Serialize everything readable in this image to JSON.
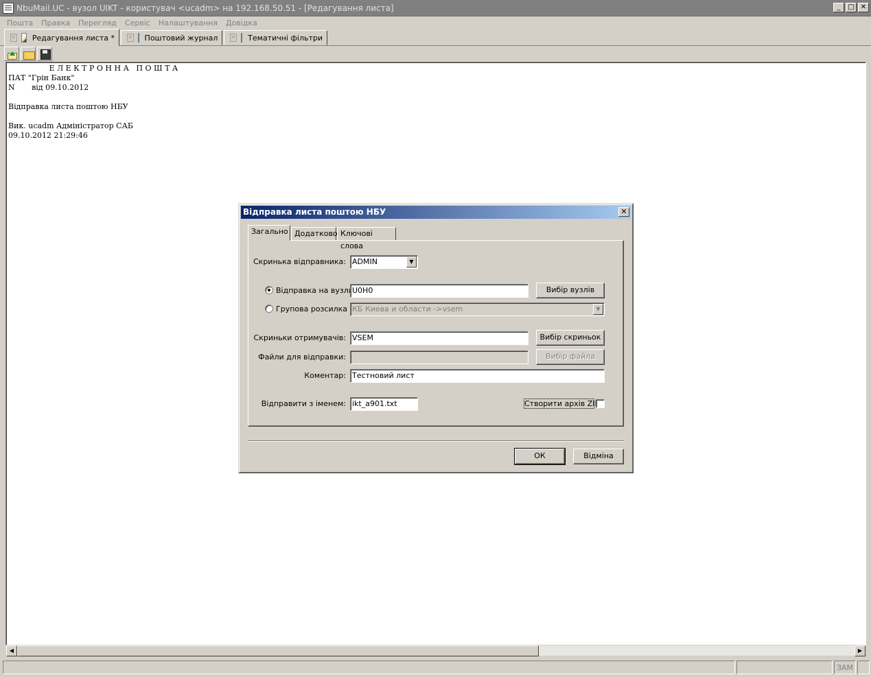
{
  "window": {
    "title": "NbuMail.UC - вузол UIKT - користувач <ucadm> на 192.168.50.51 - [Редагування листа]",
    "min": "_",
    "max": "□",
    "close": "✕"
  },
  "menu": [
    "Пошта",
    "Правка",
    "Перегляд",
    "Сервіс",
    "Налаштування",
    "Довідка"
  ],
  "doc_tabs": [
    "Редагування листа *",
    "Поштовий журнал",
    "Тематичні фільтри"
  ],
  "editor": {
    "text": "                 Е Л Е К Т Р О Н Н А   П О Ш Т А\nПАТ \"Грін Банк\"\nN       від 09.10.2012\n\nВідправка листа поштою НБУ\n\nВик. ucadm Адміністратор САБ\n09.10.2012 21:29:46"
  },
  "status": {
    "caps": "ЗАМ"
  },
  "dialog": {
    "title": "Відправка листа поштою НБУ",
    "tabs": [
      "Загально",
      "Додатково",
      "Ключові слова"
    ],
    "sender_box_label": "Скринька відправника:",
    "sender_box_value": "ADMIN",
    "send_to_nodes_label": "Відправка на вузли",
    "send_to_nodes_value": "U0H0",
    "select_nodes_button": "Вибір вузлів",
    "group_mailing_label": "Групова розсилка",
    "group_mailing_value": "КБ Киева и области ->vsem",
    "recipient_boxes_label": "Скриньки отримувачів:",
    "recipient_boxes_value": "VSEM",
    "select_boxes_button": "Вибір скриньок",
    "files_label": "Файли для відправки:",
    "files_value": "",
    "select_file_button": "Вибір файла",
    "comment_label": "Коментар:",
    "comment_value": "Тестновий лист",
    "send_name_label": "Відправити з іменем:",
    "send_name_value": "ikt_a901.txt",
    "zip_label": "Створити архів ZIP",
    "ok_button": "ОК",
    "cancel_button": "Відміна",
    "close": "✕"
  }
}
